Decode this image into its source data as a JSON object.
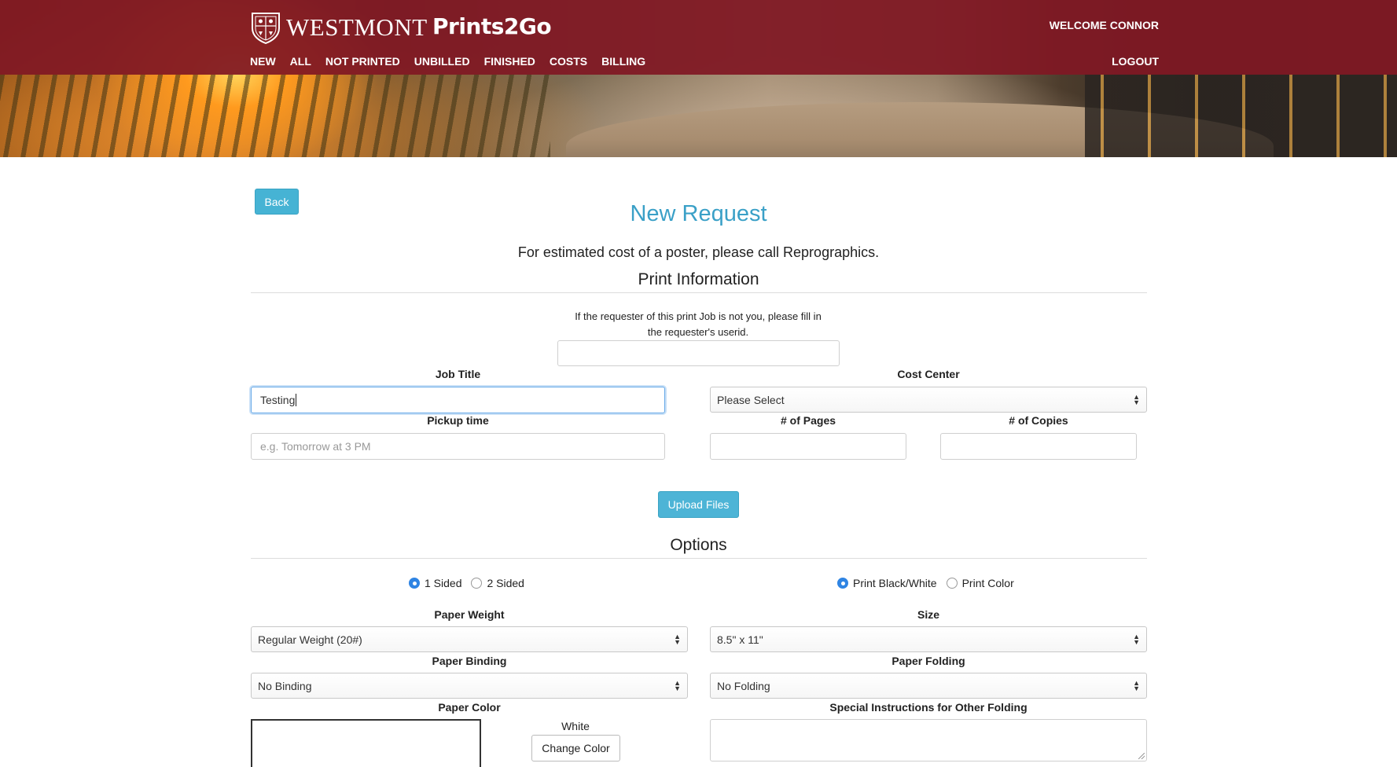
{
  "header": {
    "logo_text": "WESTMONT",
    "app_name": "Prints2Go",
    "welcome": "WELCOME CONNOR",
    "logout": "LOGOUT",
    "nav": [
      "NEW",
      "ALL",
      "NOT PRINTED",
      "UNBILLED",
      "FINISHED",
      "COSTS",
      "BILLING"
    ],
    "brand_color": "#801824"
  },
  "main": {
    "back_label": "Back",
    "title": "New Request",
    "subtitle": "For estimated cost of a poster, please call Reprographics.",
    "print_info_title": "Print Information",
    "requester_note_line1": "If the requester of this print Job is not you, please fill in",
    "requester_note_line2": "the requester's userid.",
    "requester_value": "",
    "job_title_label": "Job Title",
    "job_title_value": "Testing",
    "cost_center_label": "Cost Center",
    "cost_center_value": "Please Select",
    "pickup_label": "Pickup time",
    "pickup_placeholder": "e.g. Tomorrow at 3 PM",
    "pages_label": "# of Pages",
    "copies_label": "# of Copies",
    "upload_label": "Upload Files",
    "accent_color": "#46b3d4"
  },
  "options": {
    "title": "Options",
    "sided": [
      {
        "label": "1 Sided",
        "checked": true
      },
      {
        "label": "2 Sided",
        "checked": false
      }
    ],
    "print_mode": [
      {
        "label": "Print Black/White",
        "checked": true
      },
      {
        "label": "Print Color",
        "checked": false
      }
    ],
    "paper_weight_label": "Paper Weight",
    "paper_weight_value": "Regular Weight (20#)",
    "size_label": "Size",
    "size_value": "8.5\" x 11\"",
    "paper_binding_label": "Paper Binding",
    "paper_binding_value": "No Binding",
    "paper_folding_label": "Paper Folding",
    "paper_folding_value": "No Folding",
    "paper_color_label": "Paper Color",
    "paper_color_name": "White",
    "change_color_label": "Change Color",
    "special_instructions_label": "Special Instructions for Other Folding"
  }
}
